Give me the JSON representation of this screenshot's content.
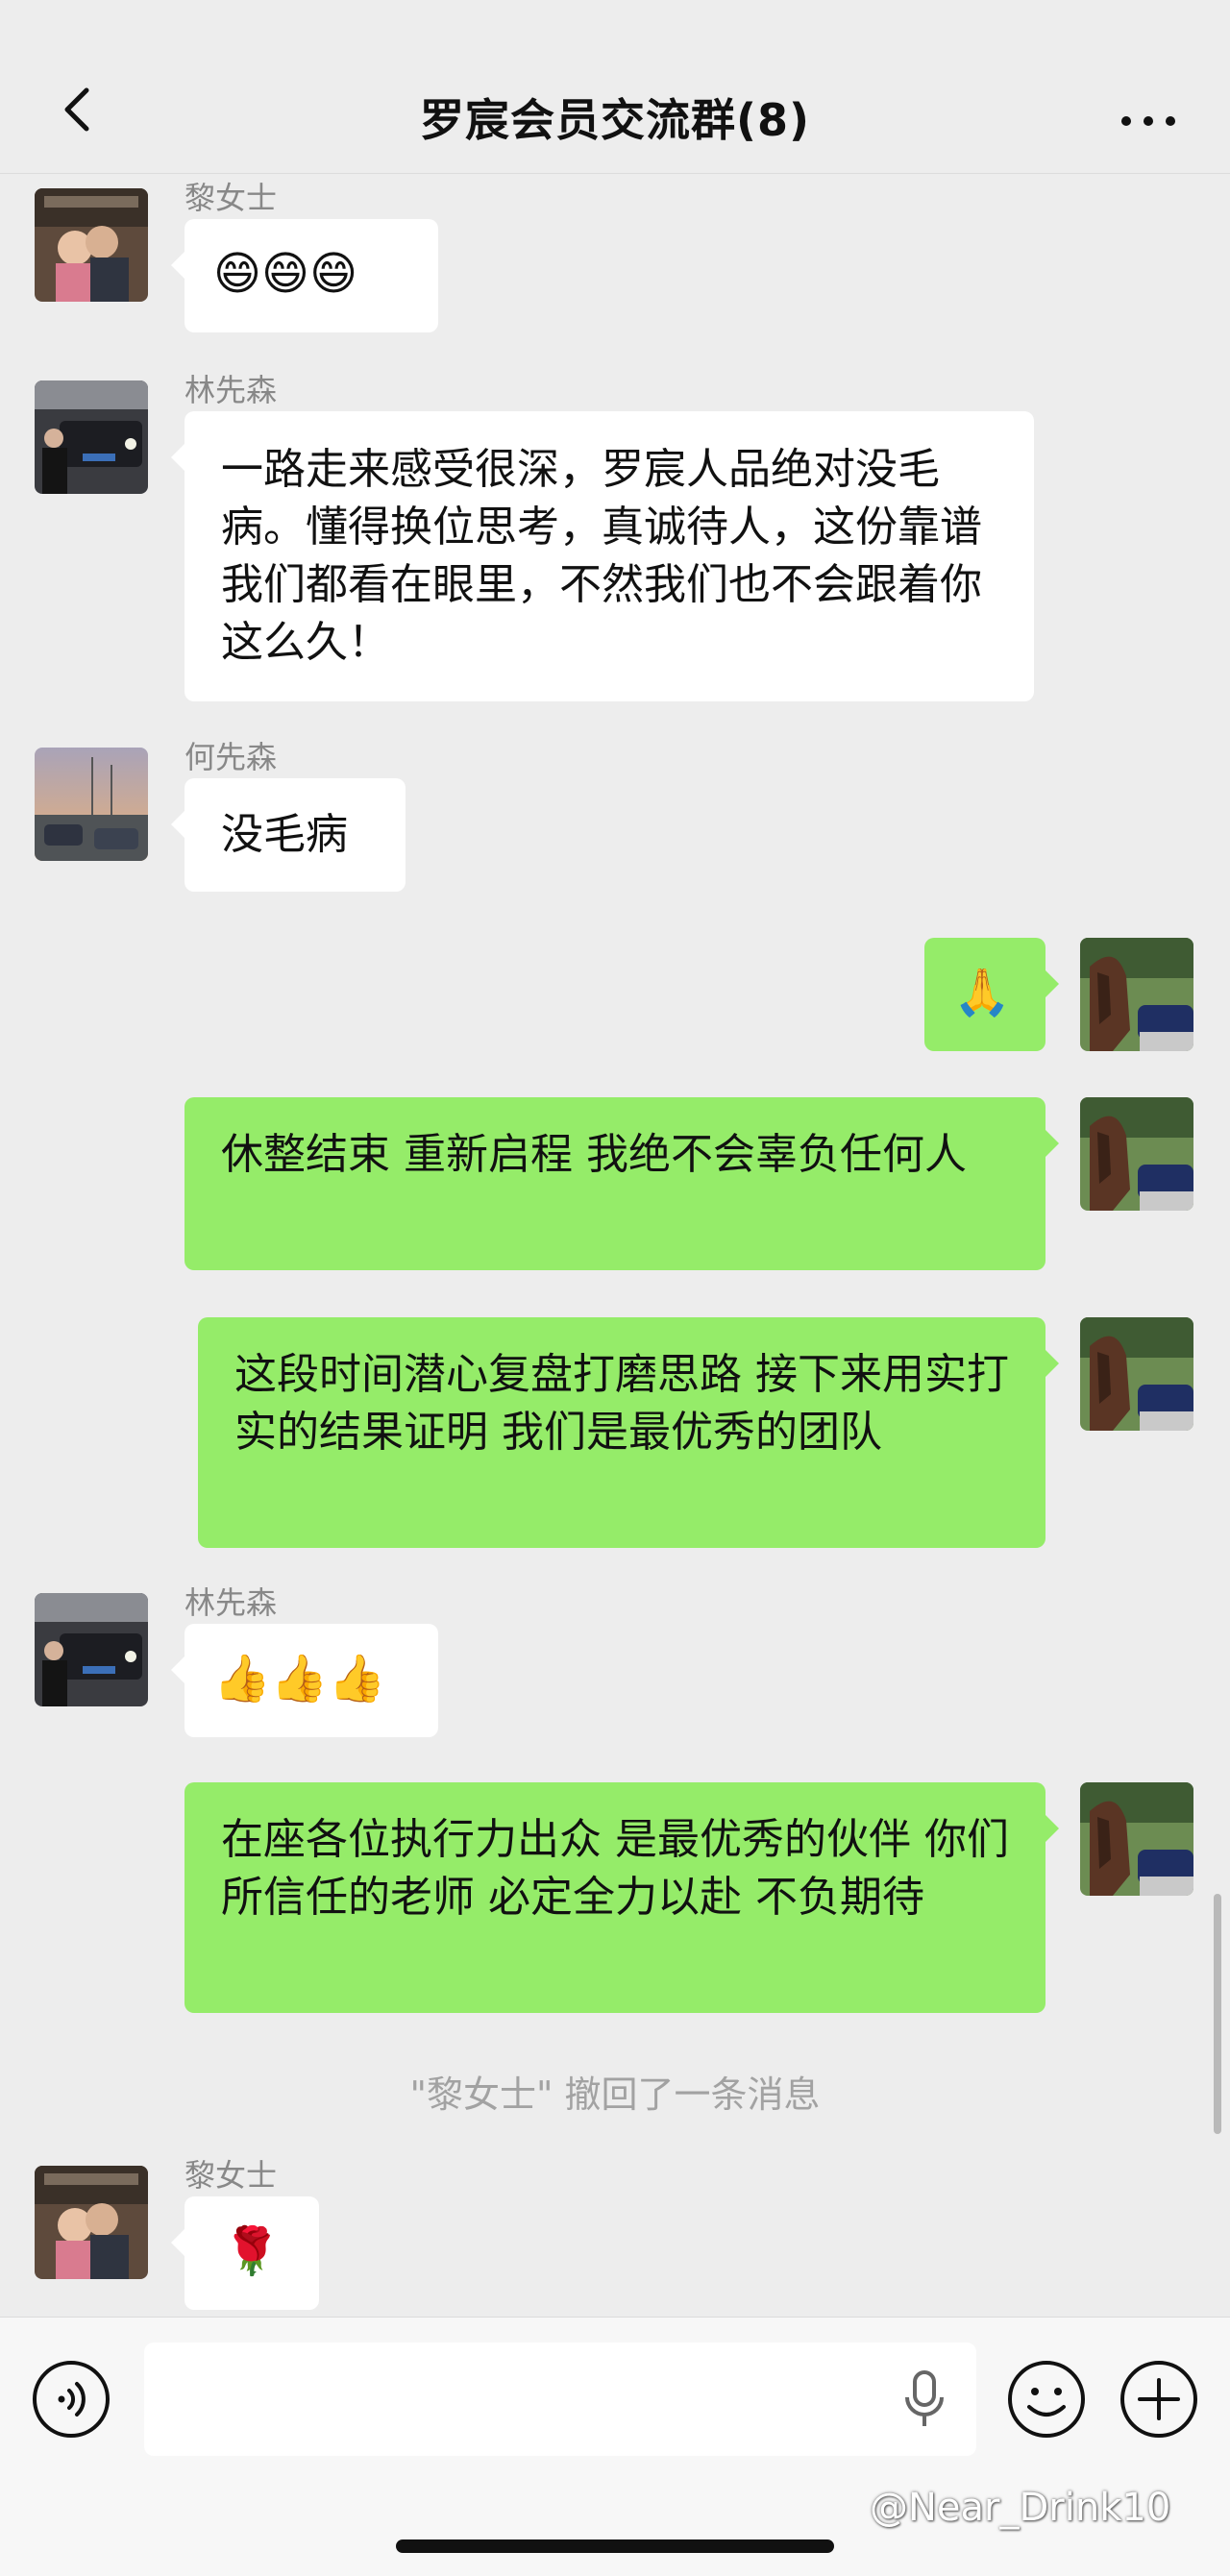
{
  "header": {
    "title": "罗宸会员交流群(8)",
    "back_icon": "chevron-left-icon",
    "more_icon": "more-horizontal-icon"
  },
  "colors": {
    "background": "#ededed",
    "incoming_bubble": "#ffffff",
    "outgoing_bubble": "#95ec69",
    "sender_name": "#888888",
    "system_note": "#a2a2a2"
  },
  "messages": [
    {
      "direction": "in",
      "sender": "黎女士",
      "text": "😄😄😄"
    },
    {
      "direction": "in",
      "sender": "林先森",
      "text": "一路走来感受很深，罗宸人品绝对没毛病。懂得换位思考，真诚待人，这份靠谱我们都看在眼里，不然我们也不会跟着你这么久！"
    },
    {
      "direction": "in",
      "sender": "何先森",
      "text": "没毛病"
    },
    {
      "direction": "out",
      "text": "🙏"
    },
    {
      "direction": "out",
      "text": "休整结束 重新启程 我绝不会辜负任何人"
    },
    {
      "direction": "out",
      "text": "这段时间潜心复盘打磨思路 接下来用实打实的结果证明 我们是最优秀的团队"
    },
    {
      "direction": "in",
      "sender": "林先森",
      "text": "👍👍👍"
    },
    {
      "direction": "out",
      "text": "在座各位执行力出众 是最优秀的伙伴 你们所信任的老师 必定全力以赴 不负期待"
    },
    {
      "direction": "in",
      "sender": "黎女士",
      "text": "🌹"
    }
  ],
  "system_note": "\"黎女士\" 撤回了一条消息",
  "input_bar": {
    "voice_icon": "voice-icon",
    "mic_icon": "mic-icon",
    "emoji_icon": "emoji-icon",
    "plus_icon": "plus-icon",
    "value": ""
  },
  "watermark": "@Near_Drink10"
}
